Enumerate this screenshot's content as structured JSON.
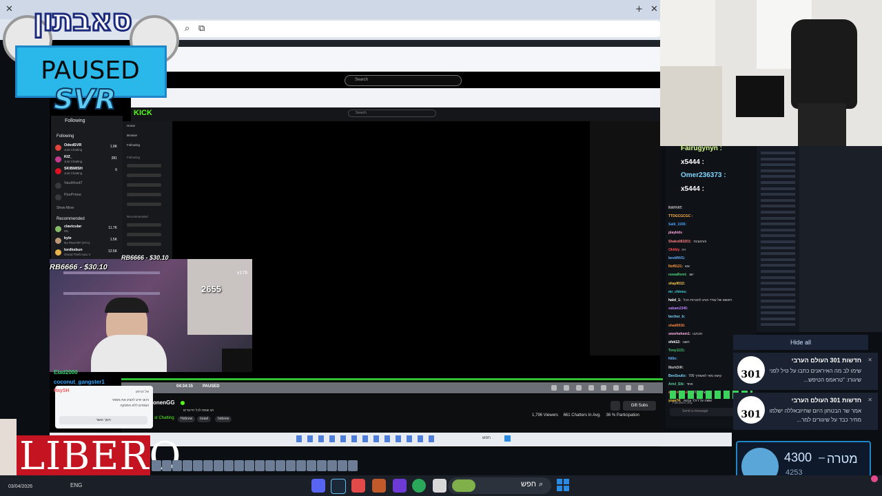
{
  "overlay": {
    "brand_logo_text": "סאבתון",
    "status_text": "PAUSED",
    "channel_tag": "SVR",
    "sponsor_text": "LIBERO"
  },
  "inner_browser": {
    "search_placeholder": "Search",
    "kick_logo": "KICK",
    "kick_search_placeholder": "Search"
  },
  "kick_sidebar": {
    "following_header": "Following",
    "following_title": "Following",
    "following_items": [
      {
        "name": "OdedSVR",
        "sub": "Just Chatting",
        "count": "1.9K"
      },
      {
        "name": "KIZ_",
        "sub": "Just Chatting",
        "count": "281"
      },
      {
        "name": "SKIBMISH",
        "sub": "Just Chatting",
        "count": "6"
      },
      {
        "name": "Vaultfred7",
        "sub": "",
        "count": ""
      },
      {
        "name": "FbePrime",
        "sub": "",
        "count": ""
      }
    ],
    "show_more": "Show More",
    "recommended_title": "Recommended",
    "recommended_items": [
      {
        "name": "clavicular",
        "sub": "IRL",
        "count": "11.7K"
      },
      {
        "name": "kyle",
        "sub": "No Pixel RP (GTA)",
        "count": "1.5K"
      },
      {
        "name": "Iordkebun",
        "sub": "Grand Theft Auto V",
        "count": "12.5K"
      }
    ],
    "nav": [
      "Home",
      "Browse",
      "Following"
    ],
    "nav_section": "Following",
    "nav_section2": "Recommended"
  },
  "stream": {
    "tip_label": "RB6666 - $30.10",
    "tip_label_small": "RB6666 - $30.10",
    "counter": "2655",
    "multiplier": "x176",
    "time": "04:34:15",
    "paused_label": "PAUSED",
    "channel_name": "onenGG",
    "channel_sub": "st Chatting",
    "channel_desc": "חג שמח לכל חיינורים",
    "tags": [
      "Hebrew",
      "Israel",
      "hebrew"
    ],
    "viewers": "1,796 Viewers",
    "chatters": "661 Chatters In Avg.",
    "participation": "36 % Participation",
    "gift_subs": "Gift Subs"
  },
  "inner_taskbar": {
    "search_text": "חפש"
  },
  "heb_popup": {
    "title": "אל הניווט",
    "body1": "ניווט יודע להציג את מספר",
    "body2": "הצופים ללא הפסקה",
    "button": "תמך ואשר"
  },
  "left_chat": {
    "lines": [
      {
        "user": "Elad2000",
        "color": "#2bd36b"
      },
      {
        "user": "coconut_gangster1",
        "color": "#2ea6ff"
      },
      {
        "user": "RaySH",
        "color": "#ff5e5e"
      }
    ]
  },
  "chat": {
    "messages": [
      {
        "user": "Fairugynyn :",
        "color": "#d6ff8a",
        "text": ""
      },
      {
        "user": "x5444 :",
        "color": "#ffffff",
        "text": ""
      },
      {
        "user": "Omer236373 :",
        "color": "#7fd6ff",
        "text": ""
      },
      {
        "user": "x5444 :",
        "color": "#ffffff",
        "text": ""
      },
      {
        "user": "RAFFAT:",
        "color": "#c7c7c7",
        "text": ""
      },
      {
        "user": "TTDGCGCGC :",
        "color": "#ffb347",
        "text": ""
      },
      {
        "user": "Salti_1935:",
        "color": "#4aa3ff",
        "text": ""
      },
      {
        "user": "playkids",
        "color": "#ffa3e0",
        "text": ""
      },
      {
        "user": "Shako083201:",
        "color": "#ff7e7e",
        "text": "והתגובות"
      },
      {
        "user": "Oklikly",
        "color": "#ff4e4e",
        "text": "ויה"
      },
      {
        "user": "besttNVG:",
        "color": "#66b3ff",
        "text": ""
      },
      {
        "user": "Nof6121:",
        "color": "#ff9a3c",
        "text": "אש"
      },
      {
        "user": "nowaRemt:",
        "color": "#4ad17a",
        "text": "ישנ"
      },
      {
        "user": "shay9012:",
        "color": "#ffd24a",
        "text": ""
      },
      {
        "user": "mr_chines:",
        "color": "#3ed3e0",
        "text": ""
      },
      {
        "user": "halel_1:",
        "color": "#ffffff",
        "text": "ראשאו של עודד הגיע לחברות הכל"
      },
      {
        "user": "sabam2345:",
        "color": "#c084ff",
        "text": ""
      },
      {
        "user": "bechor_b:",
        "color": "#7fd6ff",
        "text": ""
      },
      {
        "user": "shad0016:",
        "color": "#ff8a3c",
        "text": ""
      },
      {
        "user": "smerkehem1:",
        "color": "#ffb3e6",
        "text": "תכתבו"
      },
      {
        "user": "ofek12:",
        "color": "#ffffff",
        "text": "תשנו"
      },
      {
        "user": "Tony1131:",
        "color": "#48c774",
        "text": ""
      },
      {
        "user": "Nt0n:",
        "color": "#66b3ff",
        "text": ""
      },
      {
        "user": "MarkDiR:",
        "color": "#c7c7c7",
        "text": ""
      },
      {
        "user": "BenSoultz:",
        "color": "#7fd6ff",
        "text": "700 קישה מאי לאשתיך"
      },
      {
        "user": "Ariel_Sib:",
        "color": "#5dd39e",
        "text": "אחד"
      },
      {
        "user": "ana_menashe",
        "color": "#ff5b5b",
        "text": "גשלה 700"
      },
      {
        "user": "yoav74:",
        "color": "#ffd24a",
        "text": "ששה על דולר עכשיו"
      }
    ],
    "followers_only": "Followers only",
    "send_placeholder": "Send a message"
  },
  "notifications": {
    "hide_all": "Hide all",
    "items": [
      {
        "logo": "301",
        "title": "חדשות 301 העולם הערבי",
        "message": "שימו לב מה האיראנים כתבו על טיל לפני שיגורו: \"טראמפ הטיפש..."
      },
      {
        "logo": "301",
        "title": "חדשות 301 העולם הערבי",
        "message": "אמר שר הבטחון היום שחיזבאללה ישלמו מחיר כבד על שיגורים למר..."
      }
    ]
  },
  "goal": {
    "label": "מטרה",
    "target": "4300",
    "current": "4253"
  },
  "taskbar": {
    "date": "03/04/2026",
    "lang": "ENG",
    "search_text": "חפש"
  },
  "colors": {
    "kick_green": "#53fc18",
    "paused_box": "#29b8e9",
    "libero_red": "#c41321",
    "goal_border": "#1e87c8"
  }
}
